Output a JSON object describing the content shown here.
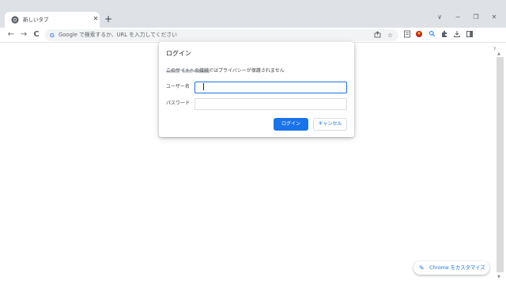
{
  "tab": {
    "title": "新しいタブ",
    "close": "✕"
  },
  "newtab": "+",
  "window_controls": {
    "minimize": "∨",
    "min": "−",
    "restore": "❐",
    "close": "✕"
  },
  "nav": {
    "back": "←",
    "forward": "→",
    "reload": "C"
  },
  "omnibox": {
    "g": "G",
    "placeholder": "Google で検索するか、URL を入力してください"
  },
  "dialog": {
    "title": "ログイン",
    "warning": "このサイトへの接続ではプライバシーが保護されません",
    "username_label": "ユーザー名",
    "password_label": "パスワード",
    "username_value": "",
    "password_value": "",
    "login_button": "ログイン",
    "cancel_button": "キャンセル"
  },
  "customize": {
    "label": "Chrome をカスタマイズ",
    "icon": "✎"
  },
  "help": "?",
  "colors": {
    "accent": "#1a73e8",
    "tabstrip": "#dee1e6",
    "omnibox": "#f1f3f4"
  }
}
